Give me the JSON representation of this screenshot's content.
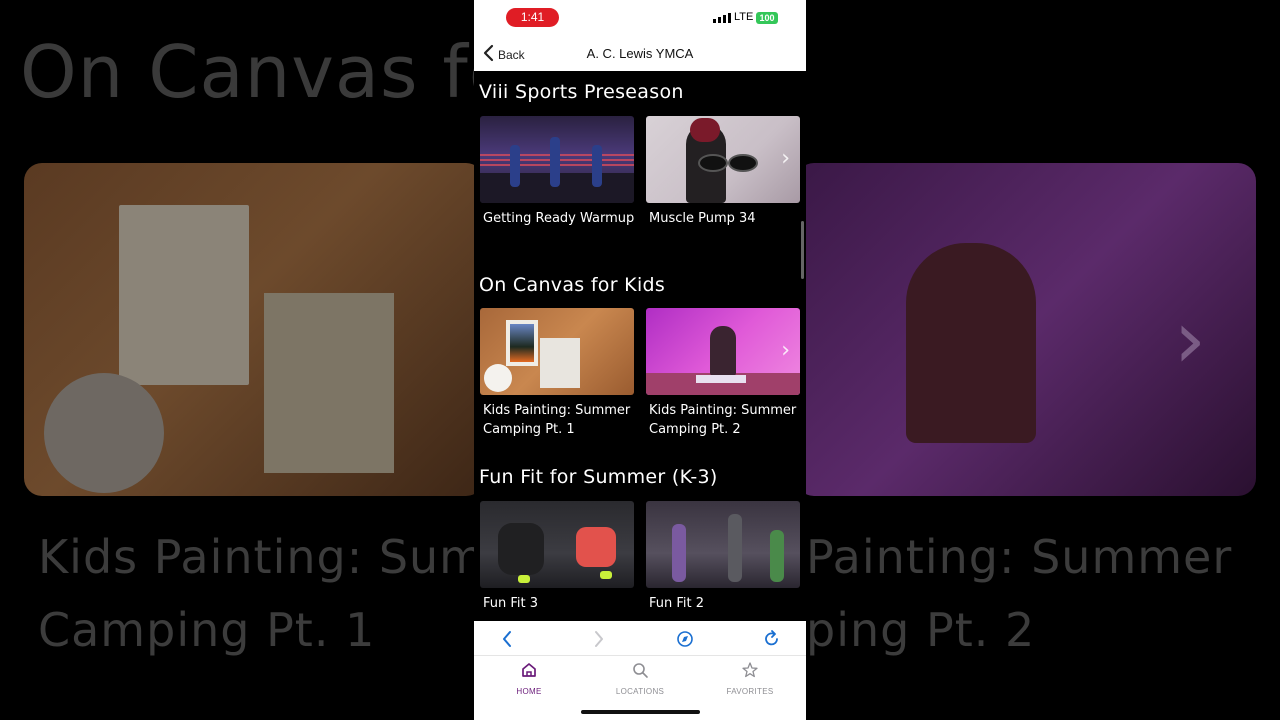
{
  "backdrop": {
    "title": "On Canvas fo",
    "left_caption_line1": "Kids Painting: Sum",
    "left_caption_line2": "Camping Pt. 1",
    "right_caption_line1": "Painting: Summer",
    "right_caption_line2": "ping Pt. 2"
  },
  "status_bar": {
    "time": "1:41",
    "network": "LTE",
    "battery": "100"
  },
  "nav": {
    "back_label": "Back",
    "title": "A. C. Lewis YMCA"
  },
  "sections": [
    {
      "title": "Viii Sports Preseason",
      "cards": [
        {
          "label": "Getting Ready Warmup"
        },
        {
          "label": "Muscle Pump 34"
        }
      ]
    },
    {
      "title": "On Canvas for Kids",
      "cards": [
        {
          "label": "Kids Painting: Summer Camping Pt. 1"
        },
        {
          "label": "Kids Painting: Summer Camping Pt. 2"
        }
      ]
    },
    {
      "title": "Fun Fit for Summer (K-3)",
      "cards": [
        {
          "label": "Fun Fit 3"
        },
        {
          "label": "Fun Fit 2"
        }
      ]
    }
  ],
  "tabs": [
    {
      "label": "HOME",
      "icon": "home-icon",
      "active": true
    },
    {
      "label": "LOCATIONS",
      "icon": "search-icon",
      "active": false
    },
    {
      "label": "FAVORITES",
      "icon": "star-icon",
      "active": false
    }
  ],
  "colors": {
    "accent": "#6a1b7a",
    "link_blue": "#1a6fd1",
    "inactive": "#8e8e93",
    "time_pill": "#e01d25",
    "battery": "#34c759"
  }
}
